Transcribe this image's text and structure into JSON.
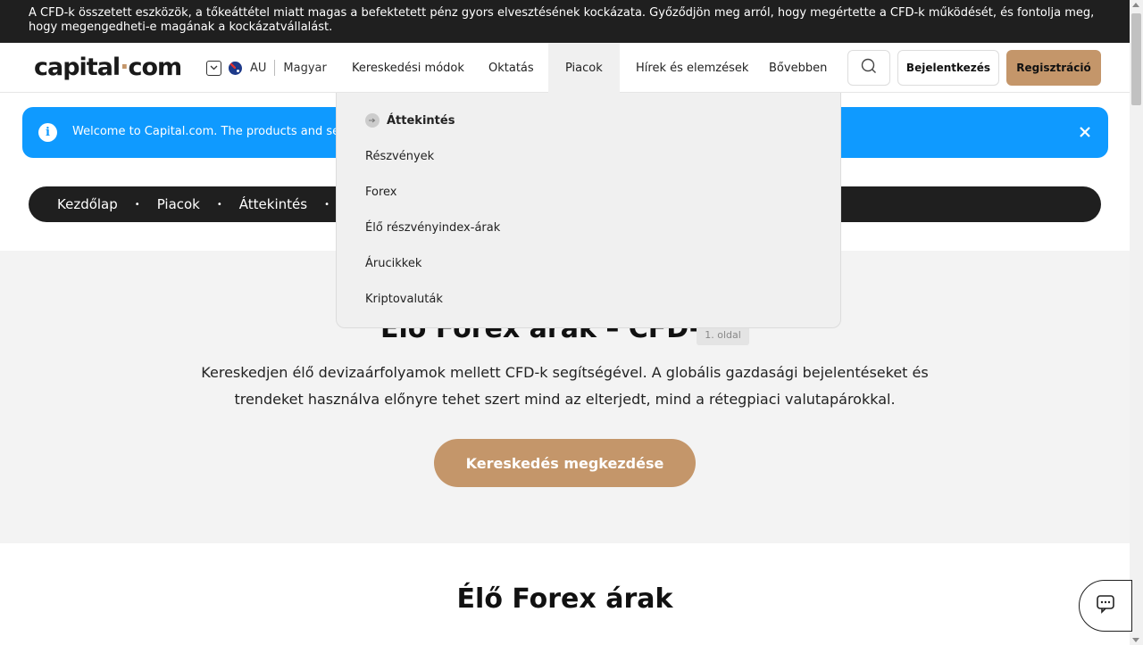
{
  "risk_warning": "A CFD-k összetett eszközök, a tőkeáttétel miatt magas a befektetett pénz gyors elvesztésének kockázata. Győződjön meg arról, hogy megértette a CFD-k működését, és fontolja meg, hogy megengedheti-e magának a kockázatvállalást.",
  "header": {
    "logo_left": "capital",
    "logo_dot": "·",
    "logo_right": "com",
    "region": "AU",
    "language": "Magyar",
    "nav": [
      "Kereskedési módok",
      "Oktatás",
      "Piacok",
      "Hírek és elemzések",
      "Bővebben"
    ],
    "active_nav": "Piacok",
    "login_label": "Bejelentkezés",
    "register_label": "Regisztráció"
  },
  "welcome_banner": {
    "text": "Welcome to Capital.com. The products and servic"
  },
  "breadcrumb": [
    "Kezdőlap",
    "Piacok",
    "Áttekintés"
  ],
  "breadcrumb_sep": "•",
  "hero": {
    "title": "Élő Forex árak – CFD-k",
    "page_badge": "1. oldal",
    "description": "Kereskedjen élő devizaárfolyamok mellett CFD-k segítségével. A globális gazdasági bejelentéseket és trendeket használva előnyre tehet szert mind az elterjedt, mind a rétegpiaci valutapárokkal.",
    "cta_label": "Kereskedés megkezdése"
  },
  "section_title": "Élő Forex árak",
  "markets_dropdown": {
    "overview": "Áttekintés",
    "items": [
      "Részvények",
      "Forex",
      "Élő részvényindex-árak",
      "Árucikkek",
      "Kriptovaluták"
    ]
  },
  "colors": {
    "brand_gold": "#c4966a",
    "info_blue": "#0f9aff",
    "dark": "#1f1f1f"
  }
}
